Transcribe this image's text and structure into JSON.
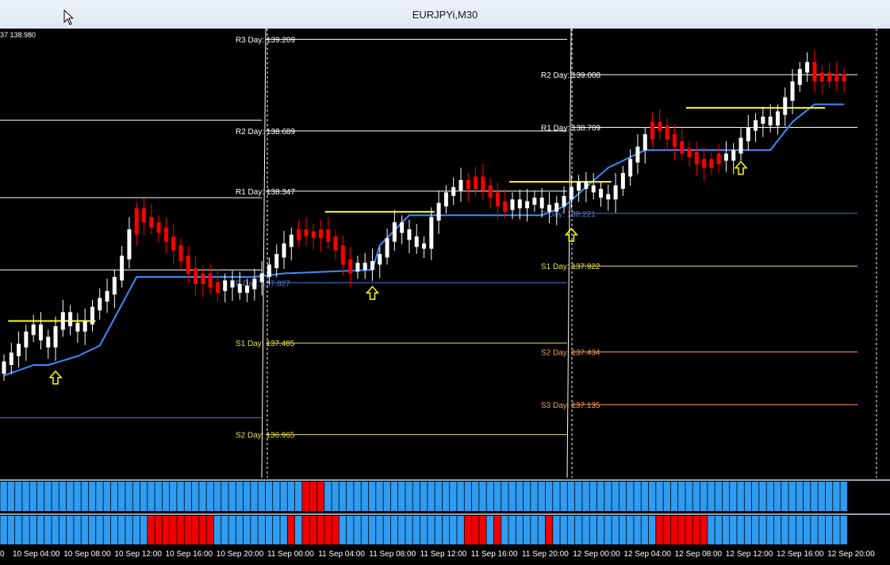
{
  "window": {
    "title": "EURJPYi,M30",
    "corner_text": "37 138.980"
  },
  "colors": {
    "background": "#000000",
    "bull_candle": "#ffffff",
    "bear_candle": "#ff0000",
    "stop_line": "#3d8cff",
    "resistance_line": "#ffff00",
    "arrow": "#ffff00",
    "pivot_white": "#ffffff",
    "pivot_blue": "#4d7bd6",
    "pivot_yellow": "#e6e04d",
    "pivot_orange": "#ff9a4d",
    "bar_blue": "#2f9cf2",
    "bar_red": "#f00000"
  },
  "chart_data": {
    "type": "candlestick",
    "symbol": "EURJPYi",
    "timeframe": "M30",
    "y_range": [
      136.72,
      139.27
    ],
    "x_labels": [
      "10 Sep 04:00",
      "10 Sep 08:00",
      "10 Sep 12:00",
      "10 Sep 16:00",
      "10 Sep 20:00",
      "11 Sep 00:00",
      "11 Sep 04:00",
      "11 Sep 08:00",
      "11 Sep 12:00",
      "11 Sep 16:00",
      "11 Sep 20:00",
      "12 Sep 00:00",
      "12 Sep 04:00",
      "12 Sep 08:00",
      "12 Sep 12:00",
      "12 Sep 16:00",
      "12 Sep 20:00"
    ],
    "x_label_first": "0",
    "pivot_days": [
      {
        "label": "11 Sep",
        "levels": [
          {
            "name": "R3 Day",
            "text": "R3 Day: 139.209",
            "value": 139.209,
            "color": "white"
          },
          {
            "name": "R2 Day",
            "text": "R2 Day: 138.689",
            "value": 138.689,
            "color": "white"
          },
          {
            "name": "R1 Day",
            "text": "R1 Day: 138.347",
            "value": 138.347,
            "color": "white"
          },
          {
            "name": "P Day",
            "text": "P Day: 137.827",
            "value": 137.827,
            "color": "blue"
          },
          {
            "name": "S1 Day",
            "text": "S1 Day: 137.485",
            "value": 137.485,
            "color": "yellow"
          },
          {
            "name": "S2 Day",
            "text": "S2 Day: 136.965",
            "value": 136.965,
            "color": "yellow"
          }
        ]
      },
      {
        "label": "12 Sep",
        "levels": [
          {
            "name": "R2 Day",
            "text": "R2 Day: 139.008",
            "value": 139.008,
            "color": "white"
          },
          {
            "name": "R1 Day",
            "text": "R1 Day: 138.709",
            "value": 138.709,
            "color": "white"
          },
          {
            "name": "P Day",
            "text": "P Day: 138.221",
            "value": 138.221,
            "color": "blue"
          },
          {
            "name": "S1 Day",
            "text": "S1 Day: 137.922",
            "value": 137.922,
            "color": "yellow"
          },
          {
            "name": "S2 Day",
            "text": "S2 Day: 137.434",
            "value": 137.434,
            "color": "orange"
          },
          {
            "name": "S3 Day",
            "text": "S3 Day: 137.135",
            "value": 137.135,
            "color": "orange"
          }
        ]
      }
    ],
    "closes": [
      137.36,
      137.41,
      137.46,
      137.53,
      137.57,
      137.5,
      137.46,
      137.56,
      137.64,
      137.58,
      137.55,
      137.59,
      137.67,
      137.72,
      137.76,
      137.84,
      137.96,
      138.11,
      138.23,
      138.18,
      138.15,
      138.12,
      138.07,
      138.02,
      137.96,
      137.89,
      137.83,
      137.86,
      137.81,
      137.78,
      137.82,
      137.8,
      137.77,
      137.79,
      137.83,
      137.86,
      137.91,
      137.97,
      138.03,
      138.08,
      138.11,
      138.1,
      138.09,
      138.11,
      138.07,
      138.02,
      137.94,
      137.89,
      137.92,
      137.9,
      137.93,
      137.97,
      138.06,
      138.15,
      138.11,
      138.07,
      138.03,
      138.02,
      138.18,
      138.26,
      138.32,
      138.35,
      138.39,
      138.37,
      138.41,
      138.36,
      138.32,
      138.27,
      138.24,
      138.28,
      138.25,
      138.27,
      138.29,
      138.25,
      138.23,
      138.26,
      138.3,
      138.35,
      138.38,
      138.36,
      138.34,
      138.31,
      138.3,
      138.36,
      138.43,
      138.51,
      138.58,
      138.65,
      138.72,
      138.7,
      138.65,
      138.61,
      138.57,
      138.55,
      138.51,
      138.49,
      138.51,
      138.54,
      138.52,
      138.56,
      138.63,
      138.69,
      138.73,
      138.75,
      138.72,
      138.78,
      138.86,
      138.95,
      139.02,
      139.06,
      138.98,
      139.0,
      138.98,
      138.99,
      138.98
    ],
    "bear_runs": [
      [
        18,
        29
      ],
      [
        40,
        47
      ],
      [
        63,
        68
      ],
      [
        88,
        97
      ],
      [
        110,
        114
      ]
    ],
    "stop_line": [
      [
        0,
        137.3
      ],
      [
        4,
        137.36
      ],
      [
        6,
        137.36
      ],
      [
        10,
        137.41
      ],
      [
        13,
        137.47
      ],
      [
        18,
        137.86
      ],
      [
        34,
        137.86
      ],
      [
        38,
        137.88
      ],
      [
        44,
        137.89
      ],
      [
        50,
        137.9
      ],
      [
        51,
        138.04
      ],
      [
        55,
        138.21
      ],
      [
        68,
        138.21
      ],
      [
        73,
        138.21
      ],
      [
        76,
        138.26
      ],
      [
        82,
        138.48
      ],
      [
        87,
        138.58
      ],
      [
        99,
        138.58
      ],
      [
        104,
        138.58
      ],
      [
        107,
        138.74
      ],
      [
        110,
        138.84
      ],
      [
        114,
        138.84
      ]
    ],
    "resistance_lines": [
      [
        1,
        12,
        137.61
      ],
      [
        44,
        58,
        138.23
      ],
      [
        69,
        82,
        138.4
      ],
      [
        93,
        111,
        138.82
      ]
    ],
    "arrows": [
      [
        7,
        137.37
      ],
      [
        50,
        137.85
      ],
      [
        77,
        138.18
      ],
      [
        100,
        138.56
      ]
    ],
    "day_separators": [
      34,
      73
    ],
    "blue_red_bars_1": {
      "red_runs": [
        [
          41,
          43
        ]
      ]
    },
    "blue_red_bars_2": {
      "red_runs": [
        [
          20,
          28
        ],
        [
          39,
          39
        ],
        [
          41,
          45
        ],
        [
          63,
          65
        ],
        [
          67,
          67
        ],
        [
          74,
          74
        ],
        [
          89,
          95
        ]
      ]
    }
  }
}
